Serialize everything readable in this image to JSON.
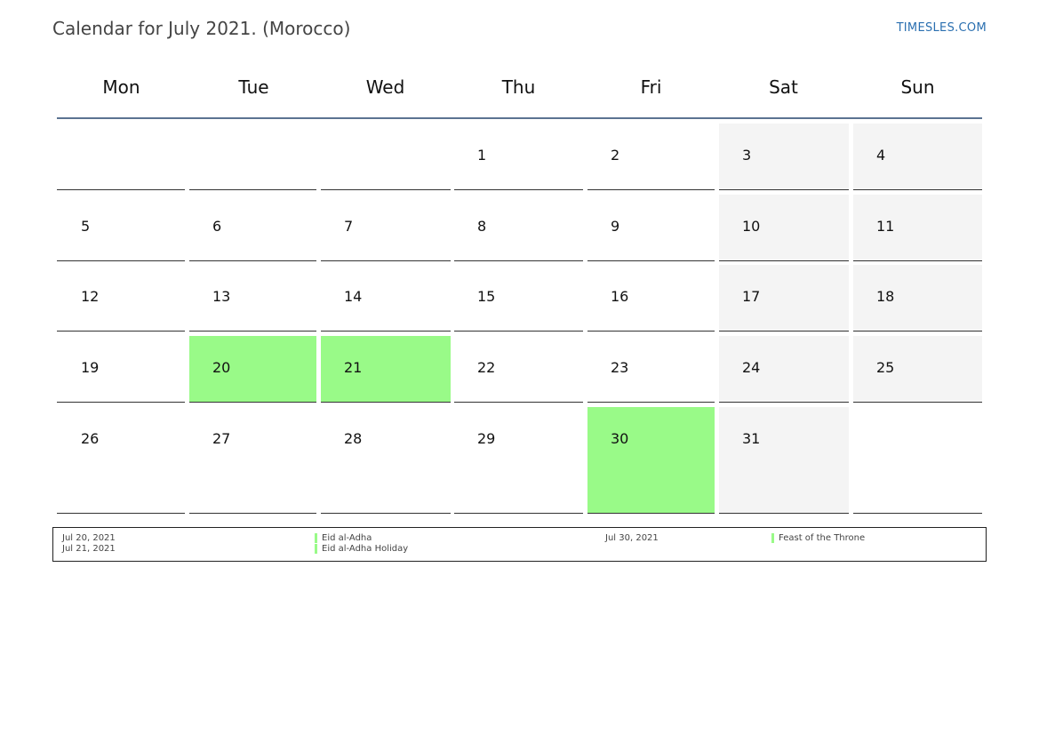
{
  "header": {
    "title": "Calendar for July 2021. (Morocco)",
    "site": "TIMESLES.COM"
  },
  "colors": {
    "holiday": "#99fa88",
    "weekend": "#f4f4f4",
    "header_rule": "#5b7391",
    "link": "#2a6fb0"
  },
  "weekdays": [
    "Mon",
    "Tue",
    "Wed",
    "Thu",
    "Fri",
    "Sat",
    "Sun"
  ],
  "weeks": [
    [
      "",
      "",
      "",
      "1",
      "2",
      "3",
      "4"
    ],
    [
      "5",
      "6",
      "7",
      "8",
      "9",
      "10",
      "11"
    ],
    [
      "12",
      "13",
      "14",
      "15",
      "16",
      "17",
      "18"
    ],
    [
      "19",
      "20",
      "21",
      "22",
      "23",
      "24",
      "25"
    ],
    [
      "26",
      "27",
      "28",
      "29",
      "30",
      "31",
      ""
    ]
  ],
  "holiday_days": [
    "20",
    "21",
    "30"
  ],
  "legend": {
    "entries": [
      {
        "date": "Jul 20, 2021",
        "name": "Eid al-Adha"
      },
      {
        "date": "Jul 21, 2021",
        "name": "Eid al-Adha Holiday"
      },
      {
        "date": "Jul 30, 2021",
        "name": "Feast of the Throne"
      }
    ]
  }
}
